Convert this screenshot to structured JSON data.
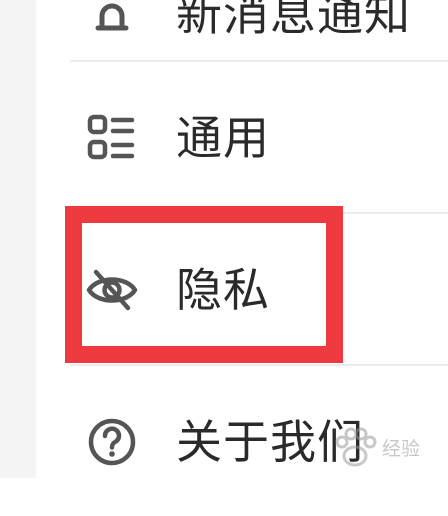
{
  "menu": {
    "items": [
      {
        "key": "notifications",
        "label": "新消息通知",
        "icon": "bell-icon"
      },
      {
        "key": "general",
        "label": "通用",
        "icon": "list-grid-icon"
      },
      {
        "key": "privacy",
        "label": "隐私",
        "icon": "eye-slash-icon"
      },
      {
        "key": "about",
        "label": "关于我们",
        "icon": "question-circle-icon"
      }
    ]
  },
  "annotation": {
    "highlight_color": "#ee3a3f",
    "target": "privacy"
  },
  "watermark": {
    "text": "经验"
  },
  "colors": {
    "text": "#2a2a2a",
    "icon": "#555555",
    "divider": "#ececec",
    "sidebar": "#f4f4f4"
  }
}
